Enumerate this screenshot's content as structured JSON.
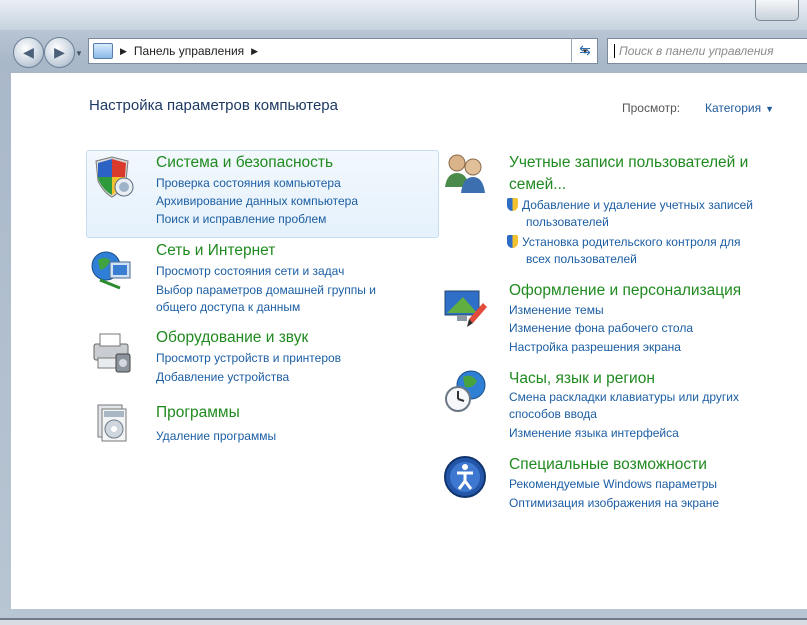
{
  "address": {
    "crumb": "Панель управления"
  },
  "search": {
    "placeholder": "Поиск в панели управления"
  },
  "page": {
    "heading": "Настройка параметров компьютера",
    "view_label": "Просмотр:",
    "view_value": "Категория"
  },
  "left": [
    {
      "title": "Система и безопасность",
      "icon": "security-shield-icon",
      "links": [
        "Проверка состояния компьютера",
        "Архивирование данных компьютера",
        "Поиск и исправление проблем"
      ]
    },
    {
      "title": "Сеть и Интернет",
      "icon": "network-globe-icon",
      "links": [
        "Просмотр состояния сети и задач",
        "Выбор параметров домашней группы и",
        "общего доступа к данным"
      ]
    },
    {
      "title": "Оборудование и звук",
      "icon": "printer-icon",
      "links": [
        "Просмотр устройств и принтеров",
        "Добавление устройства"
      ]
    },
    {
      "title": "Программы",
      "icon": "programs-icon",
      "links": [
        "Удаление программы"
      ]
    }
  ],
  "right": [
    {
      "title_line1": "Учетные записи пользователей и",
      "title_line2": "семей...",
      "icon": "users-icon",
      "links": [
        "Добавление и удаление учетных записей",
        "пользователей",
        "Установка родительского контроля для",
        "всех пользователей"
      ]
    },
    {
      "title": "Оформление и персонализация",
      "icon": "display-paint-icon",
      "links": [
        "Изменение темы",
        "Изменение фона рабочего стола",
        "Настройка разрешения экрана"
      ]
    },
    {
      "title": "Часы, язык и регион",
      "icon": "clock-globe-icon",
      "links": [
        "Смена раскладки клавиатуры или других",
        "способов ввода",
        "Изменение языка интерфейса"
      ]
    },
    {
      "title": "Специальные возможности",
      "icon": "accessibility-icon",
      "links": [
        "Рекомендуемые Windows параметры",
        "Оптимизация изображения на экране"
      ]
    }
  ]
}
